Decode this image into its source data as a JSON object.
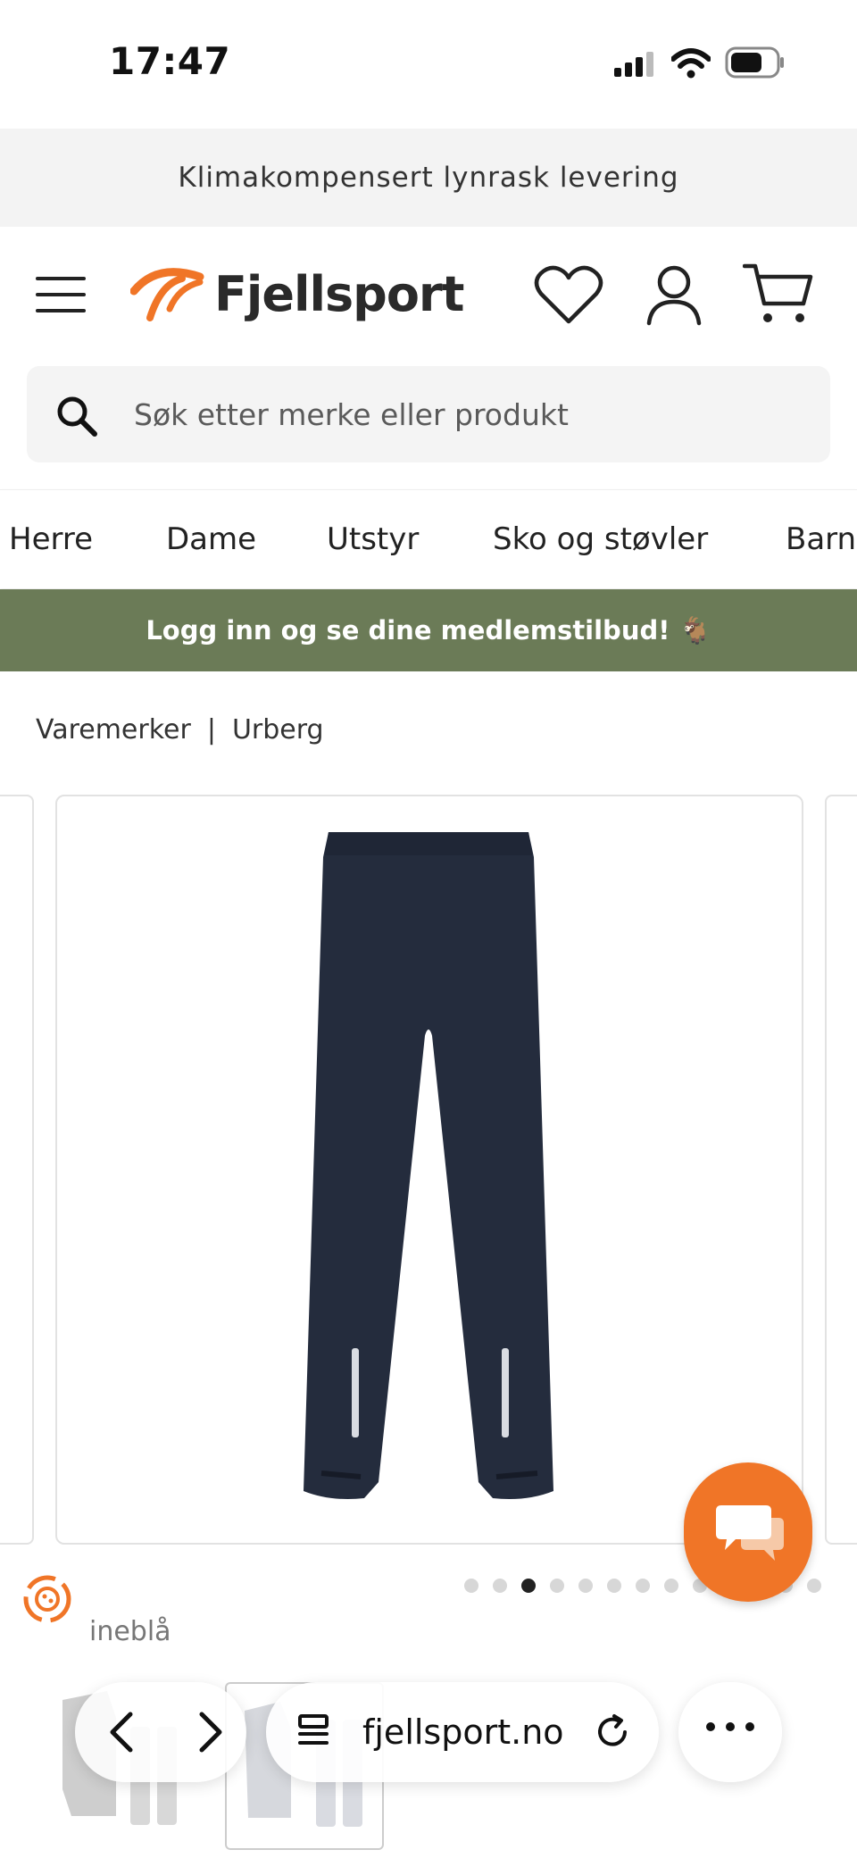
{
  "status_bar": {
    "time": "17:47",
    "icons": [
      "signal-icon",
      "wifi-icon",
      "battery-icon"
    ]
  },
  "promo": {
    "text": "Klimakompensert lynrask levering"
  },
  "header": {
    "logo_text": "Fjellsport",
    "icons": [
      "menu-icon",
      "heart-icon",
      "user-icon",
      "cart-icon"
    ],
    "accent_color": "#f07527"
  },
  "search": {
    "placeholder": "Søk etter merke eller produkt"
  },
  "categories": [
    "Herre",
    "Dame",
    "Utstyr",
    "Sko og støvler",
    "Barn"
  ],
  "member_bar": {
    "text": "Logg inn og se dine medlemstilbud! 🐐",
    "bg_color": "#6b7b57"
  },
  "breadcrumb": {
    "items": [
      "Varemerker",
      "Urberg"
    ],
    "separator": "|"
  },
  "product": {
    "color_name": "ineblå",
    "carousel": {
      "total": 13,
      "active_index": 2
    }
  },
  "browser": {
    "url": "fjellsport.no",
    "icons": [
      "back-icon",
      "forward-icon",
      "tabs-icon",
      "reload-icon",
      "more-icon"
    ]
  }
}
